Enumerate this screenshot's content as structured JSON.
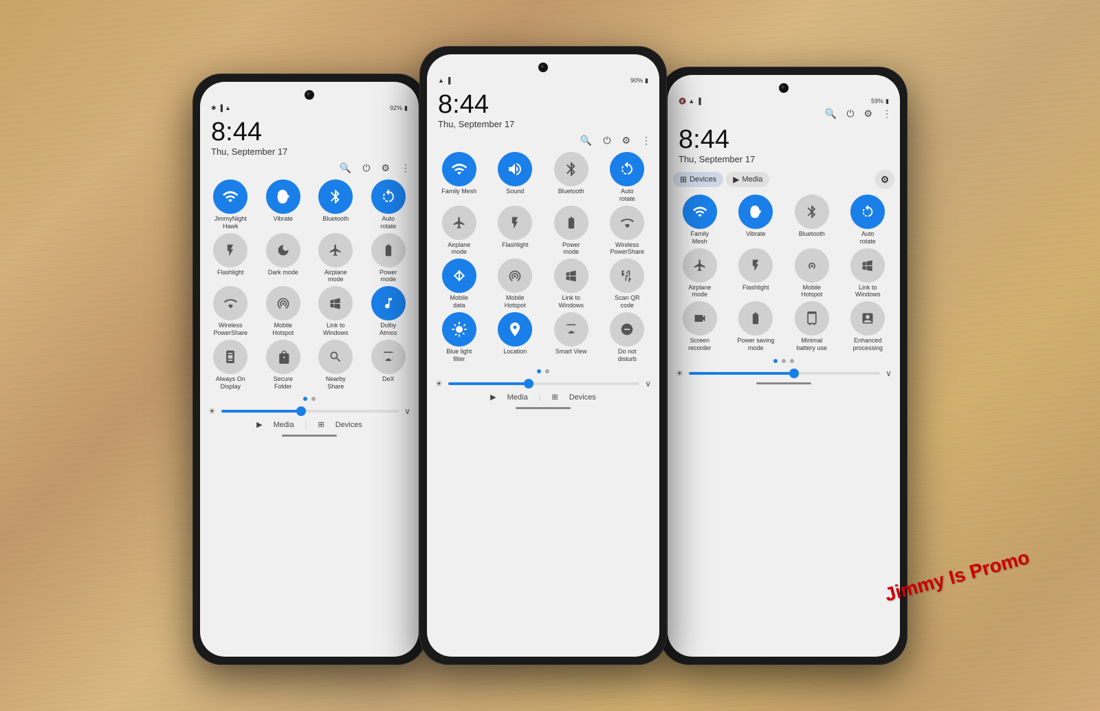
{
  "background": "#c8a46a",
  "watermark": "Jimmy Is Promo",
  "phones": {
    "left": {
      "time": "8:44",
      "date": "Thu, September 17",
      "battery": "92%",
      "tiles": [
        {
          "label": "JimmyNight\nHawk",
          "active": true,
          "icon": "📶"
        },
        {
          "label": "Vibrate",
          "active": true,
          "icon": "🔔"
        },
        {
          "label": "Bluetooth",
          "active": true,
          "icon": "🔵"
        },
        {
          "label": "Auto\nrotate",
          "active": true,
          "icon": "🔄"
        },
        {
          "label": "Flashlight",
          "active": false,
          "icon": "🔦"
        },
        {
          "label": "Dark mode",
          "active": false,
          "icon": "🌙"
        },
        {
          "label": "Airplane\nmode",
          "active": false,
          "icon": "✈"
        },
        {
          "label": "Power\nmode",
          "active": false,
          "icon": "🔋"
        },
        {
          "label": "Wireless\nPowerShare",
          "active": false,
          "icon": "📡"
        },
        {
          "label": "Mobile\nHotspot",
          "active": false,
          "icon": "📱"
        },
        {
          "label": "Link to\nWindows",
          "active": false,
          "icon": "🖥"
        },
        {
          "label": "Dolby\nAtmos",
          "active": true,
          "icon": "🎵"
        },
        {
          "label": "Always On\nDisplay",
          "active": false,
          "icon": "📺"
        },
        {
          "label": "Secure\nFolder",
          "active": false,
          "icon": "📁"
        },
        {
          "label": "Nearby\nShare",
          "active": false,
          "icon": "📲"
        },
        {
          "label": "DeX",
          "active": false,
          "icon": "💻"
        }
      ],
      "brightness": 45,
      "media_label": "Media",
      "devices_label": "Devices"
    },
    "mid": {
      "time": "8:44",
      "date": "Thu, September 17",
      "battery": "90%",
      "tiles": [
        {
          "label": "Family Mesh",
          "active": true,
          "icon": "📶"
        },
        {
          "label": "Sound",
          "active": true,
          "icon": "🔊"
        },
        {
          "label": "Bluetooth",
          "active": false,
          "icon": "🔵"
        },
        {
          "label": "Auto\nrotate",
          "active": true,
          "icon": "🔄"
        },
        {
          "label": "Airplane\nmode",
          "active": false,
          "icon": "✈"
        },
        {
          "label": "Flashlight",
          "active": false,
          "icon": "🔦"
        },
        {
          "label": "Power\nmode",
          "active": false,
          "icon": "🔋"
        },
        {
          "label": "Wireless\nPowerShare",
          "active": false,
          "icon": "📡"
        },
        {
          "label": "Mobile\ndata",
          "active": true,
          "icon": "📶"
        },
        {
          "label": "Mobile\nHotspot",
          "active": false,
          "icon": "📱"
        },
        {
          "label": "Link to\nWindows",
          "active": false,
          "icon": "🖥"
        },
        {
          "label": "Scan QR\ncode",
          "active": false,
          "icon": "📷"
        },
        {
          "label": "Blue light\nfilter",
          "active": true,
          "icon": "💡"
        },
        {
          "label": "Location",
          "active": true,
          "icon": "📍"
        },
        {
          "label": "Smart View",
          "active": false,
          "icon": "📺"
        },
        {
          "label": "Do not\ndisturb",
          "active": false,
          "icon": "🔕"
        }
      ],
      "brightness": 42,
      "media_label": "Media",
      "devices_label": "Devices"
    },
    "right": {
      "time": "8:44",
      "date": "Thu, September 17",
      "battery": "59%",
      "tabs": [
        "Devices",
        "Media"
      ],
      "tiles": [
        {
          "label": "Family\nMesh",
          "active": true,
          "icon": "📶"
        },
        {
          "label": "Vibrate",
          "active": true,
          "icon": "🔔"
        },
        {
          "label": "Bluetooth",
          "active": false,
          "icon": "🔵"
        },
        {
          "label": "Auto\nrotate",
          "active": true,
          "icon": "🔄"
        },
        {
          "label": "Airplane\nmode",
          "active": false,
          "icon": "✈"
        },
        {
          "label": "Flashlight",
          "active": false,
          "icon": "🔦"
        },
        {
          "label": "Mobile\nHotspot",
          "active": false,
          "icon": "📱"
        },
        {
          "label": "Link to\nWindows",
          "active": false,
          "icon": "🖥"
        },
        {
          "label": "Screen\nrecorder",
          "active": false,
          "icon": "🎥"
        },
        {
          "label": "Power saving\nmode",
          "active": false,
          "icon": "🔋"
        },
        {
          "label": "Minimal\nbattery use",
          "active": false,
          "icon": "⚡"
        },
        {
          "label": "Enhanced\nprocessing",
          "active": false,
          "icon": "💫"
        }
      ],
      "brightness": 55,
      "dots": 3
    }
  },
  "icons": {
    "search": "🔍",
    "power": "⏻",
    "settings": "⚙",
    "more": "⋮",
    "media": "▶",
    "devices": "⊞",
    "wifi": "wifi",
    "bluetooth_sym": "₿",
    "sun": "☀"
  }
}
